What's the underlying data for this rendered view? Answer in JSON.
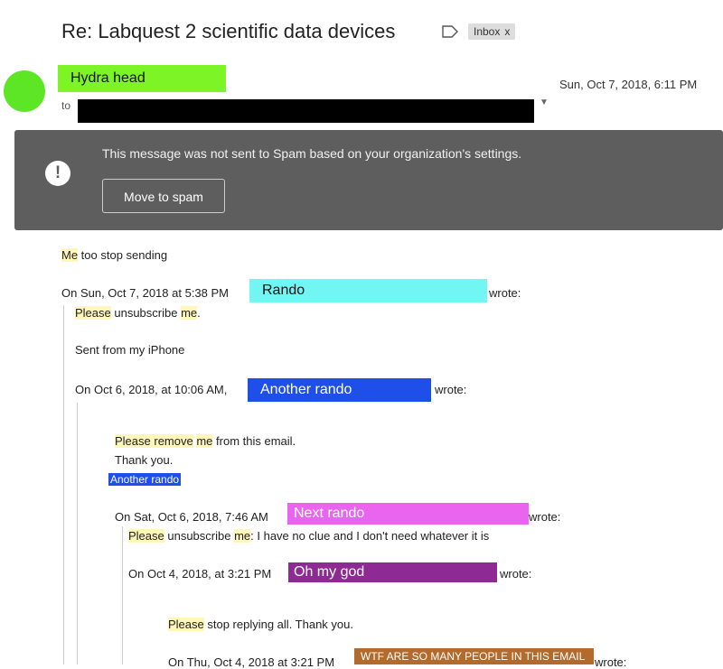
{
  "email": {
    "subject": "Re: Labquest 2 scientific data devices",
    "label_chip": "Inbox",
    "label_chip_close": "x",
    "sender_name": "Hydra head",
    "sent_date": "Sun, Oct 7, 2018, 6:11 PM",
    "to_label": "to"
  },
  "banner": {
    "message": "This message was not sent to Spam based on your organization's settings.",
    "button_label": "Move to spam",
    "icon": "!"
  },
  "body": {
    "reply_me": "Me",
    "reply_rest": " too stop sending",
    "q1_prefix": "On Sun, Oct 7, 2018 at 5:38 PM",
    "q1_name": "Rando",
    "q1_suffix": "wrote:",
    "q1_please": "Please",
    "q1_mid": " unsubscribe ",
    "q1_me": "me",
    "q1_end": ".",
    "q1_sig": "Sent from my iPhone",
    "q2_prefix": "On Oct 6, 2018, at 10:06 AM,",
    "q2_name": "Another rando",
    "q2_suffix": "wrote:",
    "q2_please_remove": "Please remove",
    "q2_space": " ",
    "q2_me": "me",
    "q2_rest": " from this email.",
    "q2_thanks": "Thank you.",
    "q2_sig": "Another rando",
    "q3_prefix": "On Sat, Oct 6, 2018, 7:46 AM",
    "q3_name": "Next rando",
    "q3_suffix": "wrote:",
    "q3_please": "Please",
    "q3_mid": " unsubscribe ",
    "q3_me": "me",
    "q3_rest": ": I have no clue and I don't need whatever it is",
    "q4_prefix": "On Oct 4, 2018, at 3:21 PM",
    "q4_name": "Oh my god",
    "q4_suffix": "wrote:",
    "q4_please": "Please",
    "q4_rest": " stop replying all. Thank you.",
    "q5_prefix": "On Thu, Oct 4, 2018 at 3:21 PM",
    "q5_name": "WTF ARE SO MANY PEOPLE IN THIS EMAIL",
    "q5_suffix": "wrote:"
  },
  "colors": {
    "sender_highlight": "#7df425",
    "avatar": "#5ce626",
    "rando": "#72f6f3",
    "another_rando": "#1e4fe9",
    "next_rando": "#ea65ef",
    "oh_my_god": "#8e2a93",
    "wtf": "#b26b2c",
    "me_highlight": "#fff6b9"
  }
}
